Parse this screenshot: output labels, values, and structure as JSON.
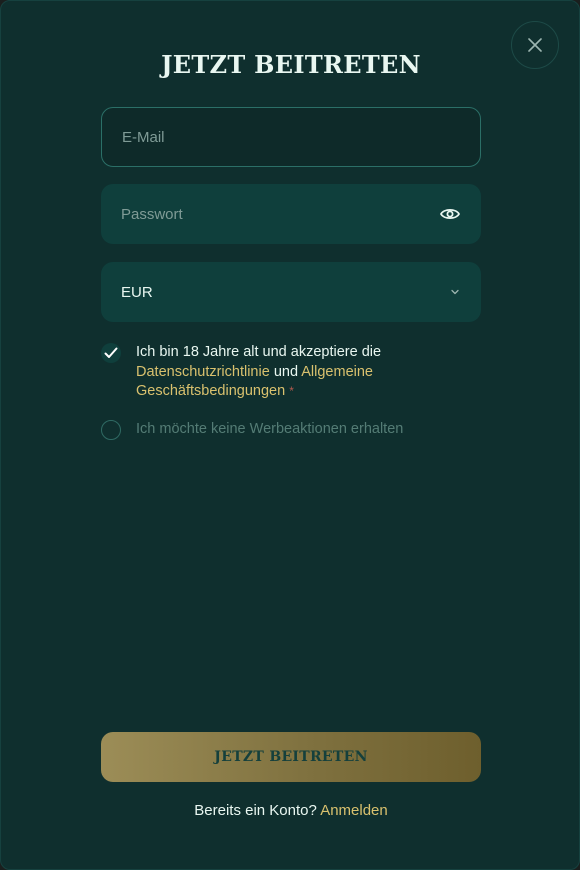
{
  "modal": {
    "title": "JETZT BEITRETEN",
    "close_icon": "close-icon"
  },
  "form": {
    "email": {
      "value": "",
      "placeholder": "E-Mail"
    },
    "password": {
      "value": "",
      "placeholder": "Passwort",
      "icon": "eye-icon"
    },
    "currency": {
      "selected": "EUR",
      "icon": "chevron-down-icon"
    },
    "terms": {
      "checked": true,
      "text_1": "Ich bin 18 Jahre alt und akzeptiere die ",
      "link_privacy": "Datenschutzrichtlinie",
      "text_2": " und ",
      "link_terms": "Allgemeine Geschäftsbedingungen",
      "required_marker": "*"
    },
    "promotions": {
      "checked": false,
      "label": "Ich möchte keine Werbeaktionen erhalten"
    },
    "submit_label": "JETZT BEITRETEN"
  },
  "footer": {
    "question": "Bereits ein Konto?",
    "login_link": "Anmelden"
  },
  "colors": {
    "background": "#0f2f2e",
    "field": "#0f3f3c",
    "accent_gold": "#d9c16e",
    "button_gradient_start": "#9c8d57",
    "button_gradient_end": "#6e5f2d"
  }
}
